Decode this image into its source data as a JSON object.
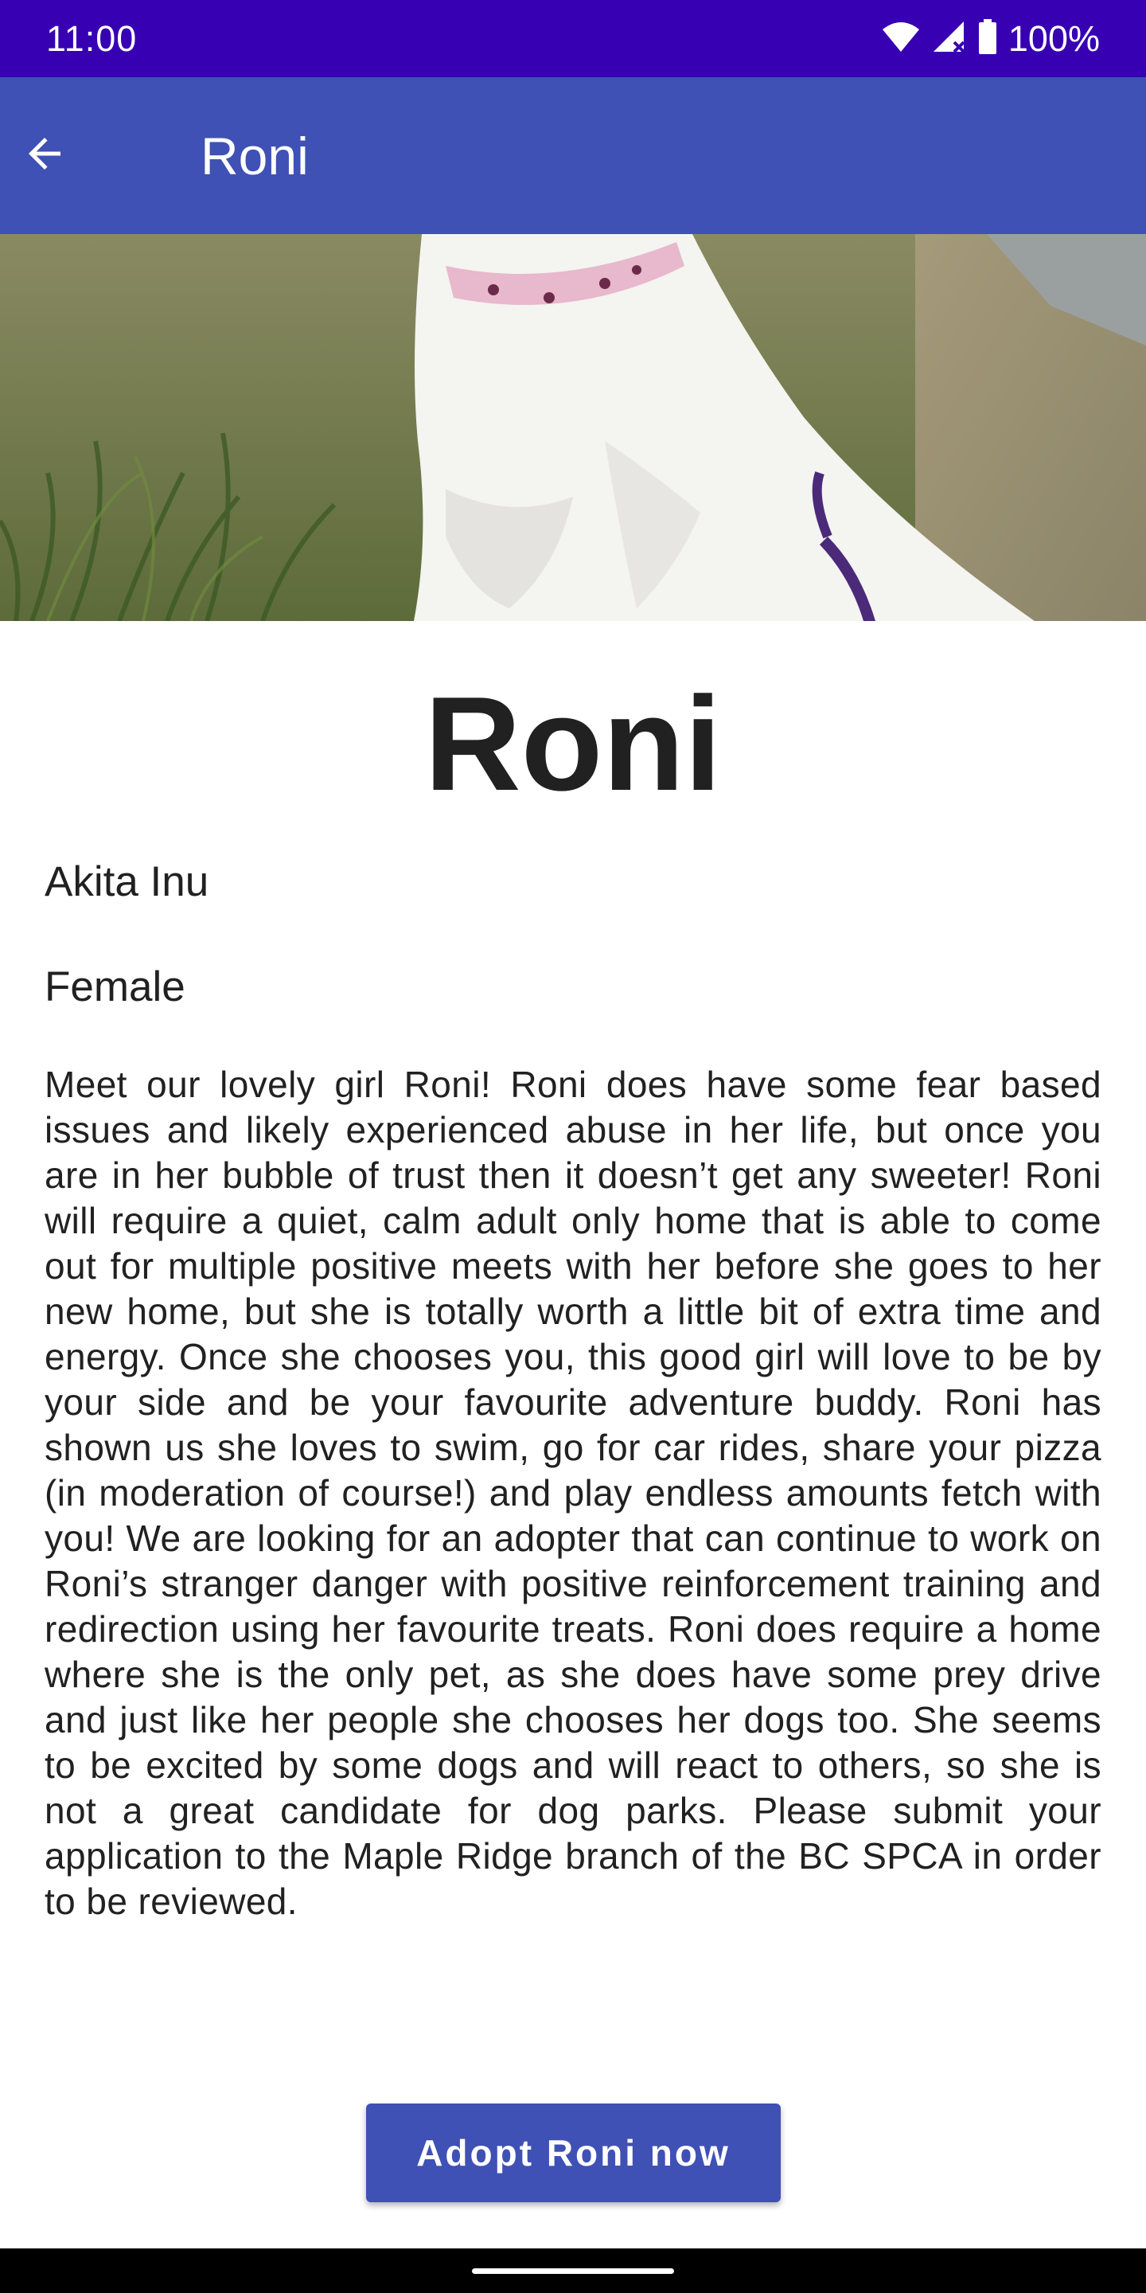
{
  "status_bar": {
    "time": "11:00",
    "battery": "100%",
    "icons": [
      "wifi-icon",
      "signal-icon",
      "battery-icon"
    ]
  },
  "app_bar": {
    "title": "Roni",
    "back_icon": "arrow-back-icon"
  },
  "hero_image": {
    "description_icon": "dog-photo"
  },
  "pet": {
    "name": "Roni",
    "breed": "Akita Inu",
    "gender": "Female",
    "description": "Meet our lovely girl Roni! Roni does have some fear based issues and likely experienced abuse in her life, but once you are in her bubble of trust then it doesn’t get any sweeter! Roni will require a quiet, calm adult only home that is able to come out for multiple positive meets with her before she goes to her new home, but she is totally worth a little bit of extra time and energy. Once she chooses you, this good girl will love to be by your side and be your favourite adventure buddy. Roni has shown us she loves to swim, go for car rides, share your pizza (in moderation of course!) and play endless amounts fetch with you! We are looking for an adopter that can continue to work on Roni’s stranger danger with positive reinforcement training and redirection using her favourite treats. Roni does require a home where she is the only pet, as she does have some prey drive and just like her people she chooses her dogs too. She seems to be excited by some dogs and will react to others, so she is not a great candidate for dog parks. Please submit your application to the Maple Ridge branch of the BC SPCA in order to be reviewed."
  },
  "actions": {
    "adopt_label": "Adopt Roni now"
  },
  "colors": {
    "status_bar": "#3700b3",
    "app_bar": "#3f51b5",
    "button": "#3f51b5"
  }
}
